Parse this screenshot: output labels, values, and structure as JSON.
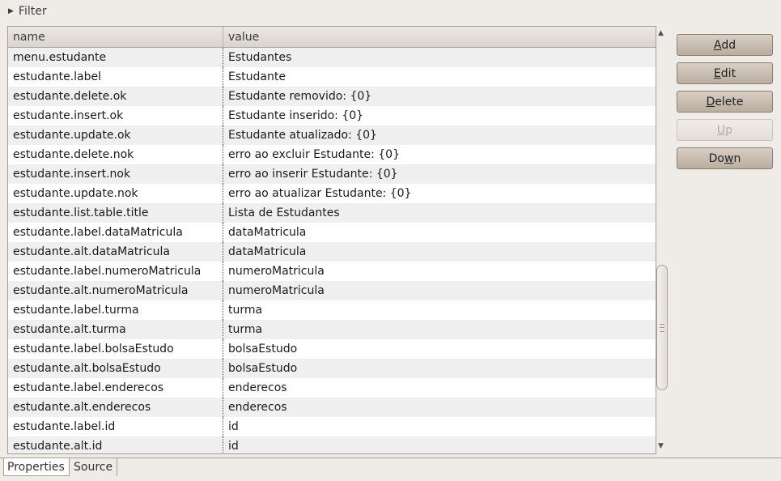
{
  "filter": {
    "label": "Filter"
  },
  "table": {
    "columns": [
      "name",
      "value"
    ],
    "rows": [
      [
        "menu.estudante",
        "Estudantes"
      ],
      [
        "estudante.label",
        "Estudante"
      ],
      [
        "estudante.delete.ok",
        "Estudante removido: {0}"
      ],
      [
        "estudante.insert.ok",
        "Estudante inserido: {0}"
      ],
      [
        "estudante.update.ok",
        "Estudante atualizado: {0}"
      ],
      [
        "estudante.delete.nok",
        "erro ao excluir Estudante: {0}"
      ],
      [
        "estudante.insert.nok",
        "erro ao inserir Estudante: {0}"
      ],
      [
        "estudante.update.nok",
        "erro ao atualizar Estudante: {0}"
      ],
      [
        "estudante.list.table.title",
        "Lista de Estudantes"
      ],
      [
        "estudante.label.dataMatricula",
        "dataMatricula"
      ],
      [
        "estudante.alt.dataMatricula",
        "dataMatricula"
      ],
      [
        "estudante.label.numeroMatricula",
        "numeroMatricula"
      ],
      [
        "estudante.alt.numeroMatricula",
        "numeroMatricula"
      ],
      [
        "estudante.label.turma",
        "turma"
      ],
      [
        "estudante.alt.turma",
        "turma"
      ],
      [
        "estudante.label.bolsaEstudo",
        "bolsaEstudo"
      ],
      [
        "estudante.alt.bolsaEstudo",
        "bolsaEstudo"
      ],
      [
        "estudante.label.enderecos",
        "enderecos"
      ],
      [
        "estudante.alt.enderecos",
        "enderecos"
      ],
      [
        "estudante.label.id",
        "id"
      ],
      [
        "estudante.alt.id",
        "id"
      ]
    ]
  },
  "buttons": {
    "add": {
      "pre": "",
      "mn": "A",
      "post": "dd"
    },
    "edit": {
      "pre": "",
      "mn": "E",
      "post": "dit"
    },
    "delete": {
      "pre": "",
      "mn": "D",
      "post": "elete"
    },
    "up": {
      "pre": "",
      "mn": "U",
      "post": "p"
    },
    "down": {
      "pre": "Do",
      "mn": "w",
      "post": "n"
    }
  },
  "tabs": {
    "properties": "Properties",
    "source": "Source"
  }
}
